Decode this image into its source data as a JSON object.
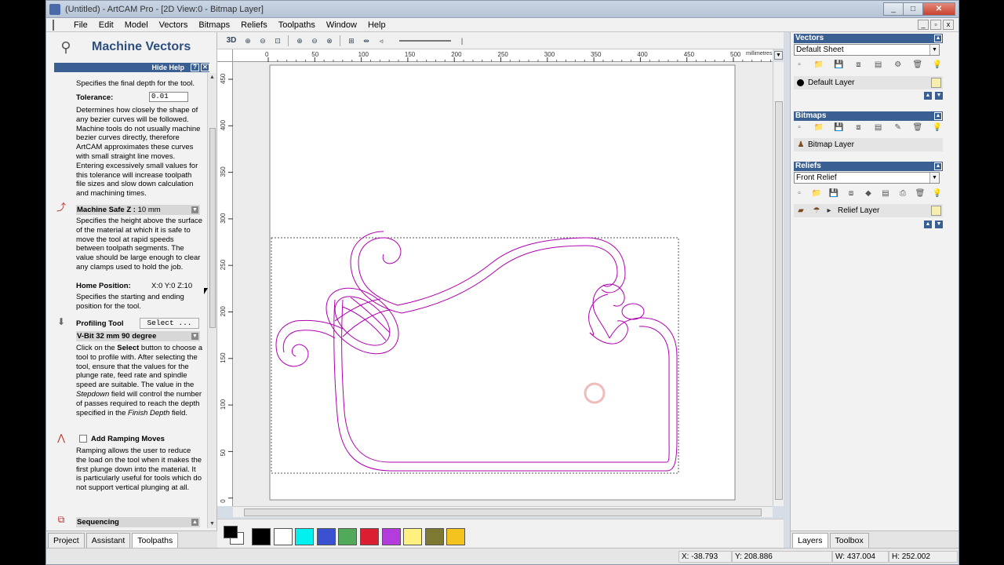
{
  "window": {
    "title": "(Untitled) - ArtCAM Pro - [2D View:0 - Bitmap Layer]",
    "buttons": {
      "minimize": "_",
      "maximize": "□",
      "close": "✕"
    }
  },
  "menu": [
    "File",
    "Edit",
    "Model",
    "Vectors",
    "Bitmaps",
    "Reliefs",
    "Toolpaths",
    "Window",
    "Help"
  ],
  "left_panel": {
    "title": "Machine Vectors",
    "hide_help": "Hide Help",
    "help_q": "?",
    "help_x": "✕",
    "finish_depth_text": "Specifies the final depth for the tool.",
    "tolerance_label": "Tolerance:",
    "tolerance_value": "0.01",
    "tolerance_text": "Determines how closely the shape of any bezier curves will be followed. Machine tools do not usually machine bezier curves directly, therefore ArtCAM approximates these curves with small straight line moves. Entering excessively small values for this tolerance will increase toolpath file sizes and slow down calculation and machining times.",
    "safe_z_label": "Machine Safe Z :",
    "safe_z_value": "10 mm",
    "safe_z_text": "Specifies the height above the surface of the material at which it is safe to move the tool at rapid speeds between toolpath segments. The value should be large enough to clear any clamps used to hold the job.",
    "home_label": "Home Position:",
    "home_value": "X:0 Y:0 Z:10",
    "home_text": "Specifies the starting and ending position for the tool.",
    "profiling_label": "Profiling Tool",
    "select_button": "Select ...",
    "tool_name": "V-Bit 32 mm 90 degree",
    "tool_text_1": "Click on the",
    "tool_text_bold": "Select",
    "tool_text_2": "button to choose a tool to profile with. After selecting the tool, ensure that the values for the plunge rate, feed rate and spindle speed are suitable. The value in the",
    "tool_text_italic_1": "Stepdown",
    "tool_text_3": "field will control the number of passes required to reach the depth specified in the",
    "tool_text_italic_2": "Finish Depth",
    "tool_text_4": "field.",
    "ramping_label": "Add Ramping Moves",
    "ramping_text": "Ramping allows the user to reduce the load on the tool when it makes the first plunge down into the material. It is particularly useful for tools which do not support vertical plunging at all.",
    "sequencing_label": "Sequencing",
    "tabs": [
      "Project",
      "Assistant",
      "Toolpaths"
    ],
    "active_tab": "Toolpaths"
  },
  "view_toolbar": {
    "view_3d": "3D"
  },
  "ruler": {
    "units": "millimetres",
    "top_ticks": [
      "0",
      "50",
      "100",
      "150",
      "200",
      "250",
      "300",
      "350",
      "400",
      "450",
      "500"
    ],
    "left_ticks": [
      "450",
      "400",
      "350",
      "300",
      "250",
      "200",
      "150",
      "100",
      "50",
      "0"
    ]
  },
  "palette": {
    "colors": [
      "#000000",
      "#ffffff",
      "#00f0f0",
      "#3c50d2",
      "#50aa5a",
      "#dc1e32",
      "#b43cdc",
      "#fff080",
      "#7d7832",
      "#f5c31e"
    ]
  },
  "right_panel": {
    "vectors": {
      "header": "Vectors",
      "sheet": "Default Sheet",
      "layer": "Default Layer"
    },
    "bitmaps": {
      "header": "Bitmaps",
      "layer": "Bitmap Layer"
    },
    "reliefs": {
      "header": "Reliefs",
      "sheet": "Front Relief",
      "layer": "Relief Layer"
    },
    "tabs": [
      "Layers",
      "Toolbox"
    ],
    "active_tab": "Layers"
  },
  "status": {
    "x": "X: -38.793",
    "y": "Y: 208.886",
    "w": "W: 437.004",
    "h": "H: 252.002"
  },
  "colors": {
    "vector": "#b000b0",
    "panel_header": "#3a5f92"
  }
}
